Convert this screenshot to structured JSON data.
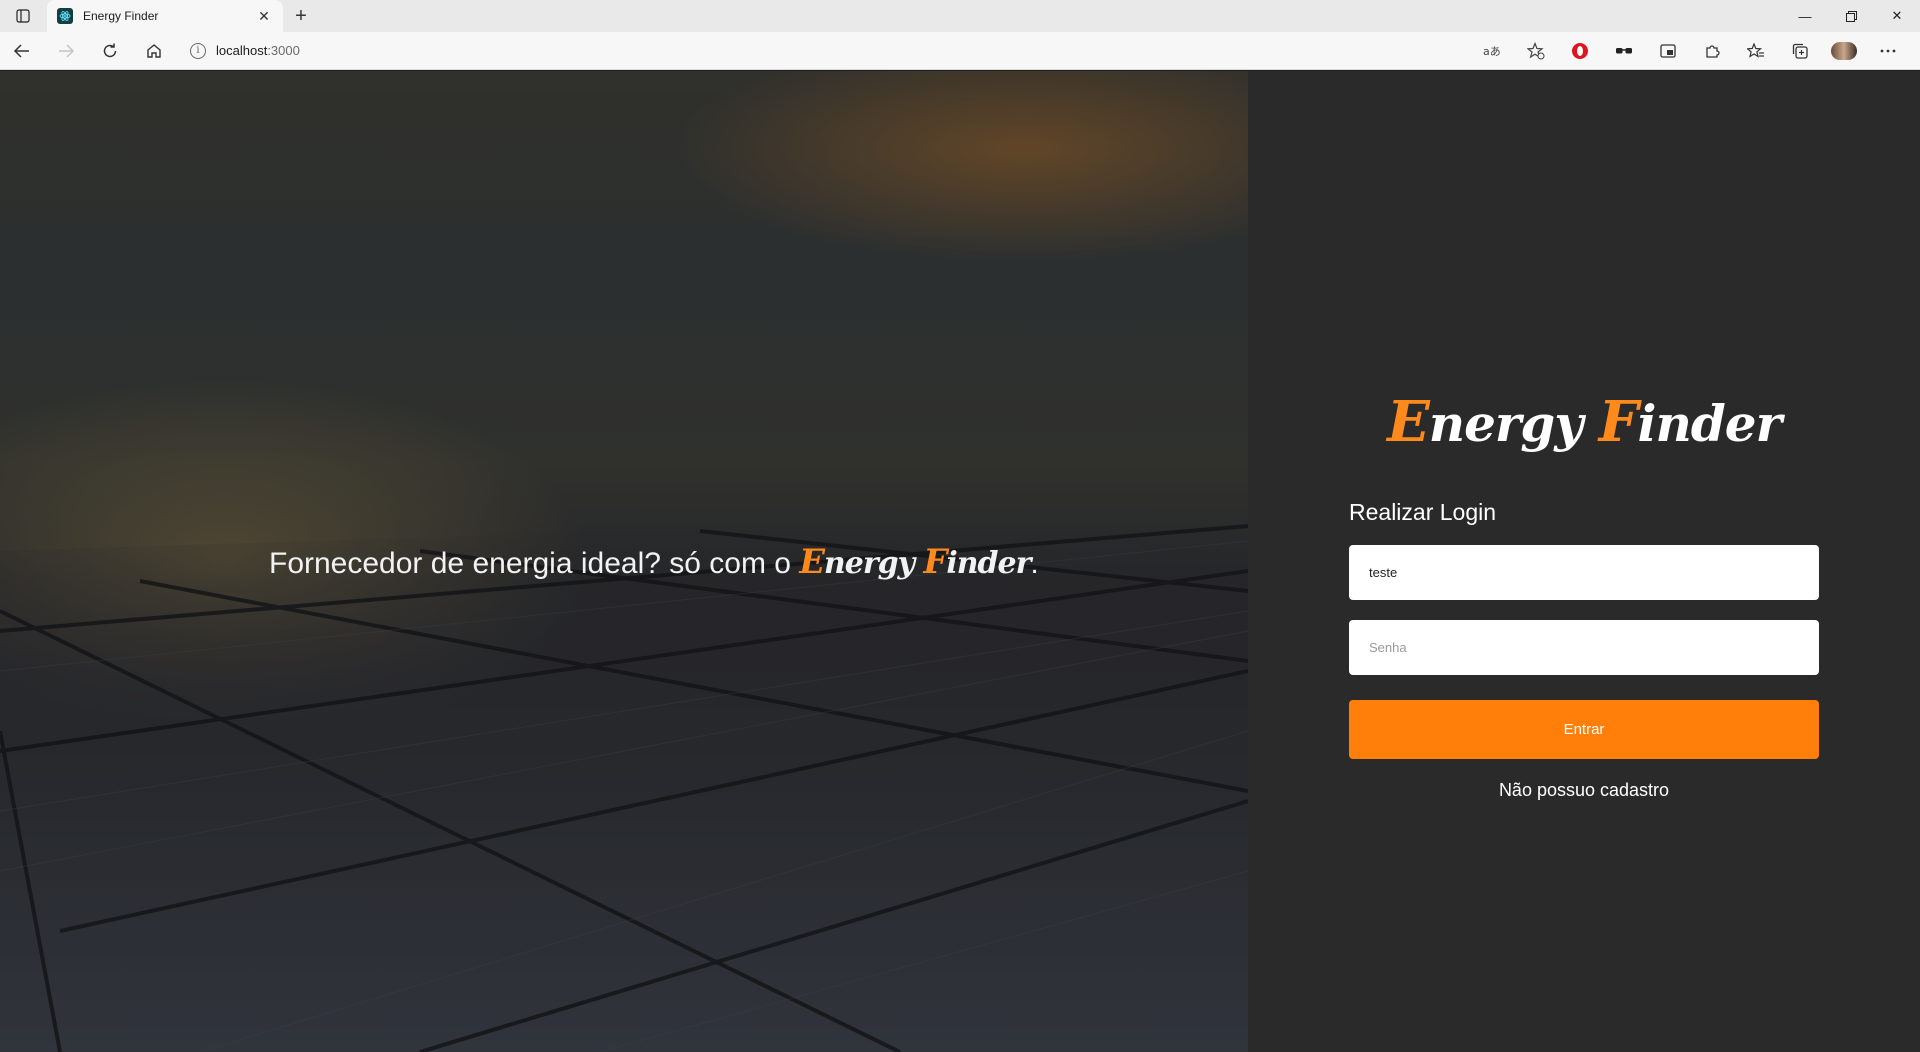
{
  "browser": {
    "tab_title": "Energy Finder",
    "tab_close_icon": "close-icon",
    "new_tab_icon": "plus-icon",
    "url_host": "localhost",
    "url_port": ":3000",
    "window_controls": [
      "minimize-icon",
      "restore-icon",
      "close-icon"
    ],
    "toolbar_icons": [
      "read-aloud-icon",
      "add-favorite-icon",
      "opera-icon",
      "glasses-icon",
      "picture-in-picture-icon",
      "extensions-icon",
      "favorites-icon",
      "collections-icon",
      "profile-avatar",
      "more-icon"
    ]
  },
  "hero": {
    "tagline": "Fornecedor de energia ideal? só com o",
    "brand_e_cap": "E",
    "brand_e_rest": "nergy",
    "brand_f_cap": "F",
    "brand_f_rest": "inder",
    "brand_suffix": "."
  },
  "login": {
    "brand_e_cap": "E",
    "brand_e_rest": "nergy",
    "brand_f_cap": "F",
    "brand_f_rest": "inder",
    "title": "Realizar Login",
    "username_value": "teste",
    "password_placeholder": "Senha",
    "submit_label": "Entrar",
    "no_account_link": "Não possuo cadastro"
  },
  "colors": {
    "accent": "#ff7f0a",
    "panel_bg": "#2a2a2a"
  }
}
